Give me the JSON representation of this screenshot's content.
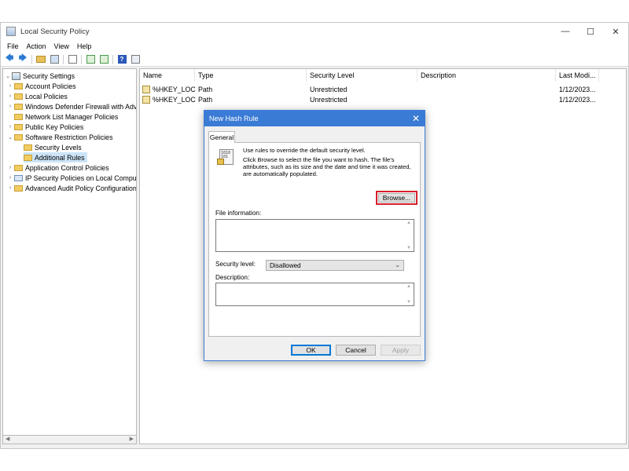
{
  "window": {
    "title": "Local Security Policy",
    "controls": {
      "minimize": "—",
      "maximize": "☐",
      "close": "✕"
    }
  },
  "menubar": [
    "File",
    "Action",
    "View",
    "Help"
  ],
  "toolbar": {
    "icons": [
      "back-icon",
      "forward-icon",
      "up-folder-icon",
      "show-hide-tree-icon",
      "properties-icon",
      "refresh-icon",
      "export-list-icon",
      "help-icon",
      "view-icon"
    ],
    "back": "🡄",
    "forward": "🡆",
    "help": "?"
  },
  "tree": {
    "items": [
      {
        "label": "Security Settings",
        "level": 0,
        "expanded": true
      },
      {
        "label": "Account Policies",
        "level": 1
      },
      {
        "label": "Local Policies",
        "level": 1
      },
      {
        "label": "Windows Defender Firewall with Adva",
        "level": 1
      },
      {
        "label": "Network List Manager Policies",
        "level": 1
      },
      {
        "label": "Public Key Policies",
        "level": 1
      },
      {
        "label": "Software Restriction Policies",
        "level": 1,
        "expanded": true
      },
      {
        "label": "Security Levels",
        "level": 2
      },
      {
        "label": "Additional Rules",
        "level": 2,
        "selected": true
      },
      {
        "label": "Application Control Policies",
        "level": 1
      },
      {
        "label": "IP Security Policies on Local Compute",
        "level": 1
      },
      {
        "label": "Advanced Audit Policy Configuration",
        "level": 1
      }
    ],
    "chevron_collapsed": "›",
    "chevron_expanded": "⌄"
  },
  "list": {
    "columns": [
      "Name",
      "Type",
      "Security Level",
      "Description",
      "Last Modi..."
    ],
    "sort_indicator": "^",
    "rows": [
      [
        "%HKEY_LOC...",
        "Path",
        "Unrestricted",
        "",
        "1/12/2023..."
      ],
      [
        "%HKEY_LOC...",
        "Path",
        "Unrestricted",
        "",
        "1/12/2023..."
      ]
    ]
  },
  "dialog": {
    "title": "New Hash Rule",
    "close": "✕",
    "tab": "General",
    "icon_text": "1010\n101",
    "intro_line1": "Use rules to override the default security level.",
    "intro_line2": "Click Browse to select the file you want to hash. The file's attributes, such as its size and the date and time it was created, are automatically populated.",
    "browse": "Browse...",
    "file_info_label": "File information:",
    "file_info_value": "",
    "security_level_label": "Security level:",
    "security_level_value": "Disallowed",
    "description_label": "Description:",
    "description_value": "",
    "ok": "OK",
    "cancel": "Cancel",
    "apply": "Apply"
  }
}
